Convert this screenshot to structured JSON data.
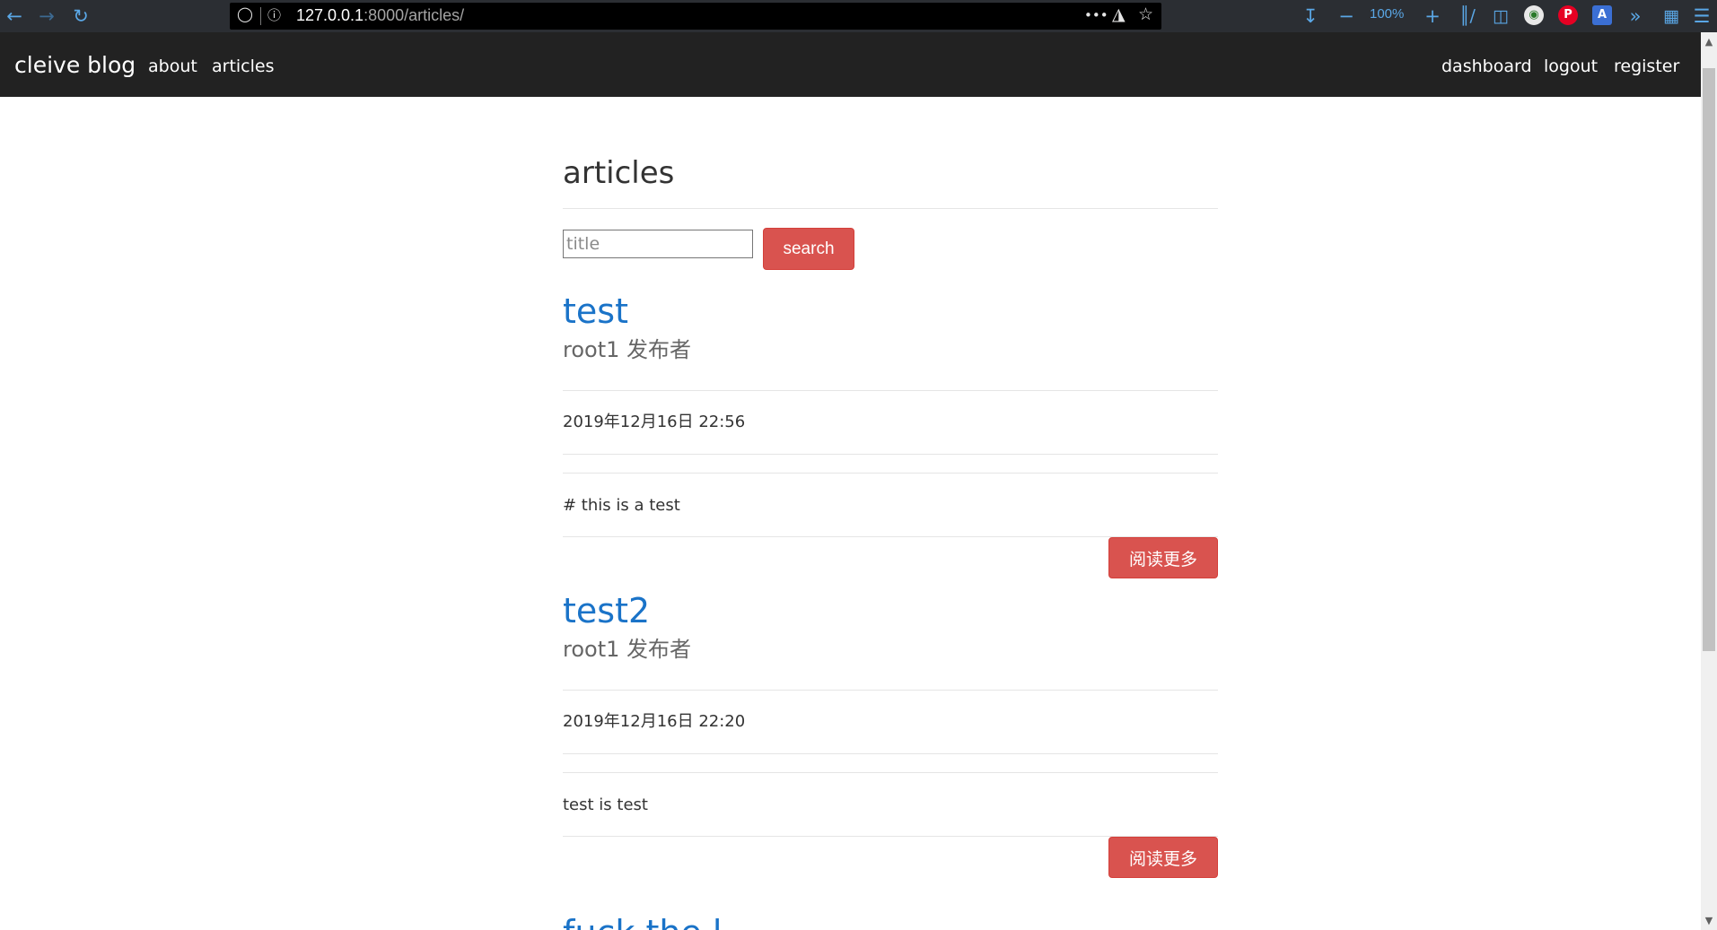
{
  "browser": {
    "url_host": "127.0.0.1",
    "url_rest": ":8000/articles/",
    "zoom": "100%",
    "more_actions_label": "•••"
  },
  "navbar": {
    "brand": "cleive blog",
    "left_links": [
      "about",
      "articles"
    ],
    "right_links": [
      "dashboard",
      "logout",
      "register"
    ]
  },
  "page": {
    "title": "articles"
  },
  "search": {
    "placeholder": "title",
    "button_label": "search"
  },
  "articles": [
    {
      "title": "test",
      "author_line": "root1 发布者",
      "date": "2019年12月16日 22:56",
      "body": "# this is a test",
      "more_label": "阅读更多"
    },
    {
      "title": "test2",
      "author_line": "root1 发布者",
      "date": "2019年12月16日 22:20",
      "body": "test is test",
      "more_label": "阅读更多"
    }
  ],
  "next_article_peek": "fuck the l",
  "colors": {
    "navbar_bg": "#222222",
    "danger_button": "#d9534f",
    "link_blue": "#1a73c8",
    "toolbar_icon_blue": "#5aa7e6"
  }
}
